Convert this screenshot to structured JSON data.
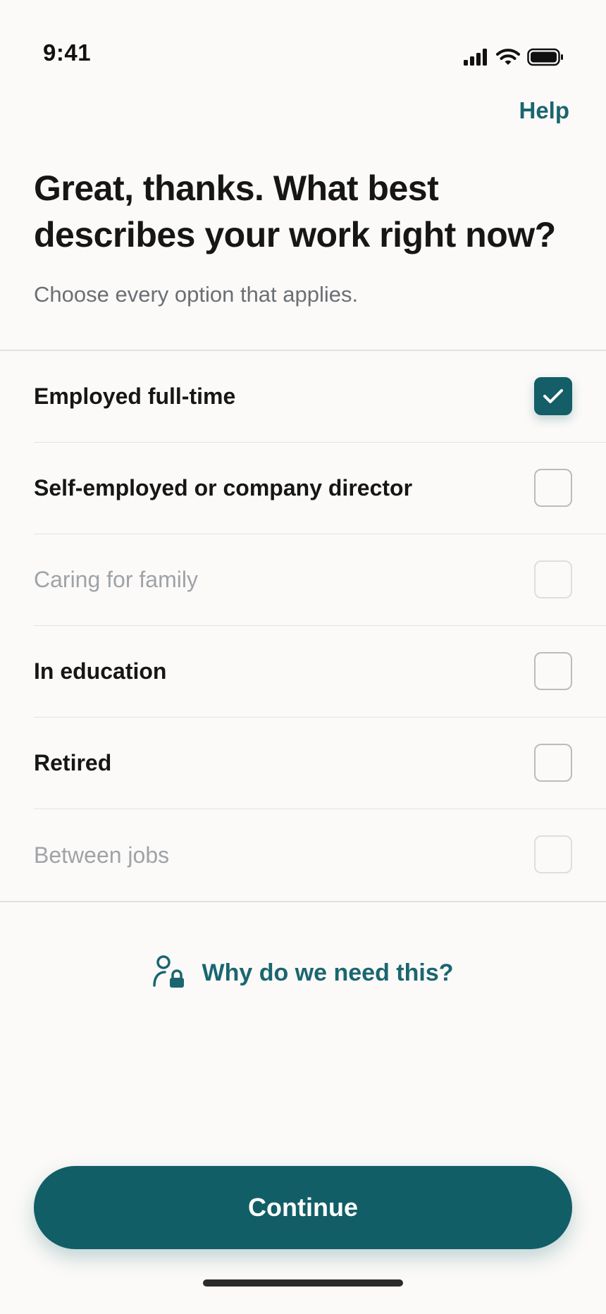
{
  "status_bar": {
    "time": "9:41",
    "icons": [
      "signal-icon",
      "wifi-icon",
      "battery-icon"
    ]
  },
  "header": {
    "help_label": "Help"
  },
  "main": {
    "title": "Great, thanks. What best describes your work right now?",
    "subtitle": "Choose every option that applies."
  },
  "options": [
    {
      "label": "Employed full-time",
      "checked": true,
      "muted": false
    },
    {
      "label": "Self-employed or company director",
      "checked": false,
      "muted": false
    },
    {
      "label": "Caring for family",
      "checked": false,
      "muted": true
    },
    {
      "label": "In education",
      "checked": false,
      "muted": false
    },
    {
      "label": "Retired",
      "checked": false,
      "muted": false
    },
    {
      "label": "Between jobs",
      "checked": false,
      "muted": true
    }
  ],
  "why_link": {
    "label": "Why do we need this?",
    "icon": "user-lock-icon"
  },
  "footer": {
    "continue_label": "Continue"
  },
  "colors": {
    "accent": "#125e66",
    "link": "#1a6670",
    "background": "#fbfaf8",
    "muted_text": "#9fa3a8"
  }
}
